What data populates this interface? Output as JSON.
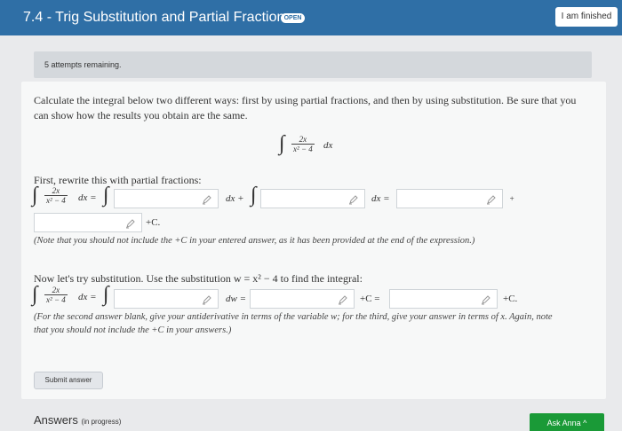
{
  "header": {
    "title": "7.4 - Trig Substitution and Partial Fractions",
    "badge": "OPEN",
    "finished_button": "I am finished"
  },
  "attempts_text": "5 attempts remaining.",
  "question": {
    "prompt_line1": "Calculate the integral below two different ways: first by using partial fractions, and then by using substitution. Be sure that you",
    "prompt_line2": "can show how the results you obtain are the same.",
    "integral": {
      "num": "2x",
      "den": "x² − 4",
      "dx": "dx"
    }
  },
  "part1": {
    "intro": "First, rewrite this with partial fractions:",
    "lhs_eq": "dx =",
    "dx_plus": "dx +",
    "dx_eq": "dx =",
    "plus": "+",
    "plus_c": "+C.",
    "note": "(Note that you should not include the +C in your entered answer, as it has been provided at the end of the expression.)"
  },
  "part2": {
    "intro": "Now let's try substitution. Use the substitution w = x² − 4 to find the integral:",
    "lhs_eq": "dx =",
    "dw": "dw =",
    "plus_c_eq": "+C =",
    "plus_c": "+C.",
    "note_line1": "(For the second answer blank, give your antiderivative in terms of the variable w; for the third, give your answer in terms of x. Again, note",
    "note_line2": "that you should not include the +C in your answers.)"
  },
  "submit_label": "Submit answer",
  "answers_label": "Answers",
  "answers_status": "(in progress)",
  "ask_label": "Ask Anna ^"
}
